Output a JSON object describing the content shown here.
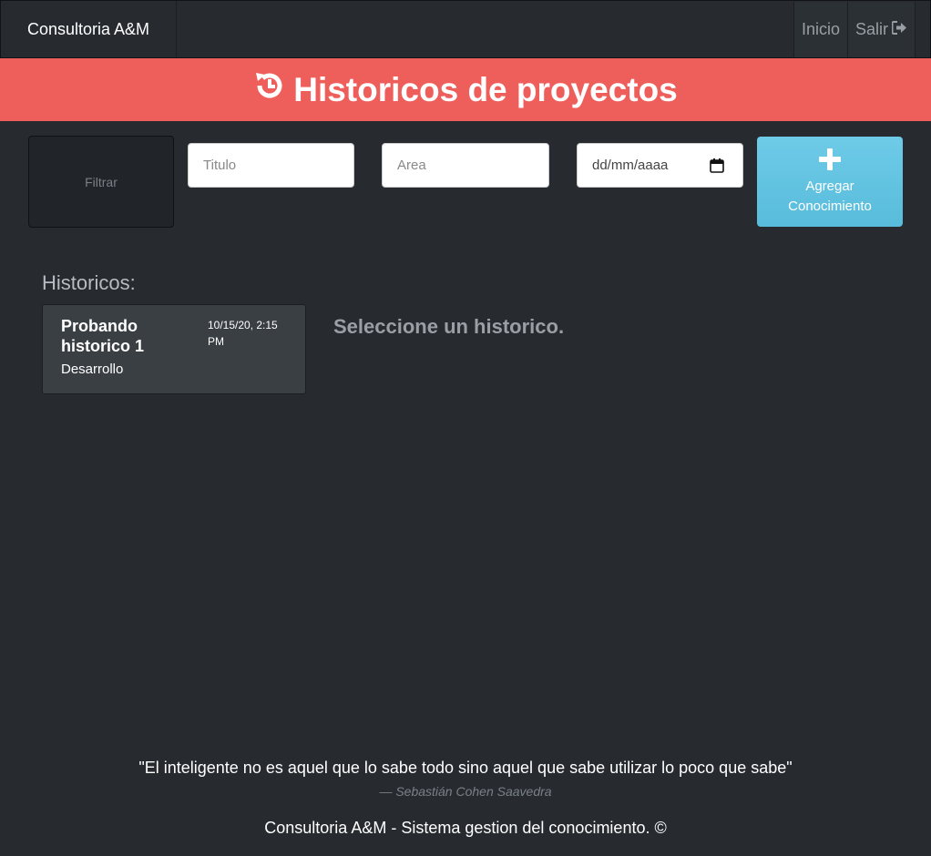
{
  "navbar": {
    "brand": "Consultoria A&M",
    "links": [
      {
        "label": "Inicio"
      },
      {
        "label": "Salir",
        "icon": "sign-out-icon"
      }
    ]
  },
  "banner": {
    "icon": "history-icon",
    "title": "Historicos de proyectos"
  },
  "filters": {
    "filter_button": "Filtrar",
    "titulo_placeholder": "Titulo",
    "area_placeholder": "Area",
    "date_placeholder": "dd/mm/aaaa",
    "add_button": {
      "icon": "plus-icon",
      "line1": "Agregar",
      "line2": "Conocimiento"
    }
  },
  "historicos": {
    "heading": "Historicos:",
    "items": [
      {
        "title": "Probando historico 1",
        "date": "10/15/20, 2:15 PM",
        "area": "Desarrollo"
      }
    ],
    "empty_message": "Seleccione un historico."
  },
  "footer": {
    "quote": "\"El inteligente no es aquel que lo sabe todo sino aquel que sabe utilizar lo poco que sabe\"",
    "author": "— Sebastián Cohen Saavedra",
    "copyright": "Consultoria A&M - Sistema gestion del conocimiento. ©"
  },
  "colors": {
    "background": "#272b30",
    "banner": "#ee5f5b",
    "add_button": "#5bc0de",
    "card": "#3a3f44"
  }
}
